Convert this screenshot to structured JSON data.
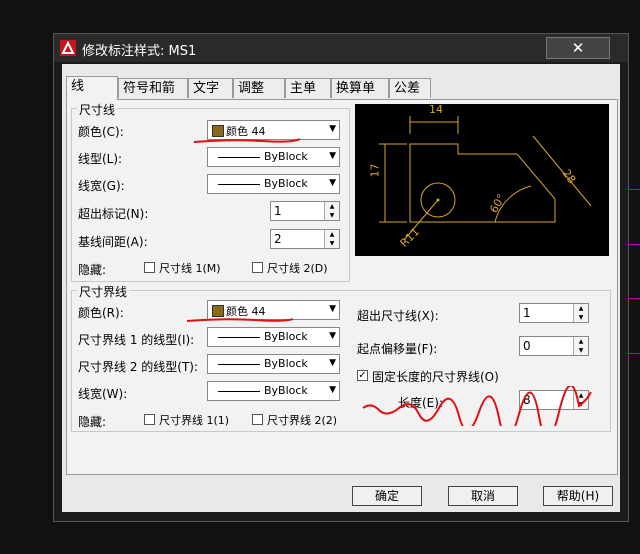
{
  "window": {
    "title": "修改标注样式: MS1",
    "close_label": "✕"
  },
  "tabs": [
    {
      "label": "线",
      "active": true
    },
    {
      "label": "符号和箭头",
      "active": false
    },
    {
      "label": "文字",
      "active": false
    },
    {
      "label": "调整",
      "active": false
    },
    {
      "label": "主单位",
      "active": false
    },
    {
      "label": "换算单位",
      "active": false
    },
    {
      "label": "公差",
      "active": false
    }
  ],
  "dim_line": {
    "legend": "尺寸线",
    "color_label": "颜色(C):",
    "color_value": "颜色 44",
    "linetype_label": "线型(L):",
    "linetype_value": "ByBlock",
    "lineweight_label": "线宽(G):",
    "lineweight_value": "ByBlock",
    "extend_ticks_label": "超出标记(N):",
    "extend_ticks_value": "1",
    "baseline_spacing_label": "基线间距(A):",
    "baseline_spacing_value": "2",
    "suppress_label": "隐藏:",
    "suppress_1_label": "尺寸线 1(M)",
    "suppress_2_label": "尺寸线 2(D)"
  },
  "ext_line": {
    "legend": "尺寸界线",
    "color_label": "颜色(R):",
    "color_value": "颜色 44",
    "linetype1_label": "尺寸界线 1 的线型(I):",
    "linetype1_value": "ByBlock",
    "linetype2_label": "尺寸界线 2 的线型(T):",
    "linetype2_value": "ByBlock",
    "lineweight_label": "线宽(W):",
    "lineweight_value": "ByBlock",
    "suppress_label": "隐藏:",
    "suppress_1_label": "尺寸界线 1(1)",
    "suppress_2_label": "尺寸界线 2(2)",
    "extend_beyond_label": "超出尺寸线(X):",
    "extend_beyond_value": "1",
    "offset_label": "起点偏移量(F):",
    "offset_value": "0",
    "fixed_length_label": "固定长度的尺寸界线(O)",
    "fixed_length_checked": true,
    "length_label": "长度(E):",
    "length_value": "8"
  },
  "preview": {
    "dim_top": "14",
    "dim_left": "17",
    "dim_right": "28",
    "dim_angle": "60°",
    "dim_radius": "R11"
  },
  "buttons": {
    "ok": "确定",
    "cancel": "取消",
    "help": "帮助(H)"
  },
  "colors": {
    "accent_red": "#e01010",
    "preview_line": "#d7a62b",
    "swatch": "#8a6a1a"
  }
}
